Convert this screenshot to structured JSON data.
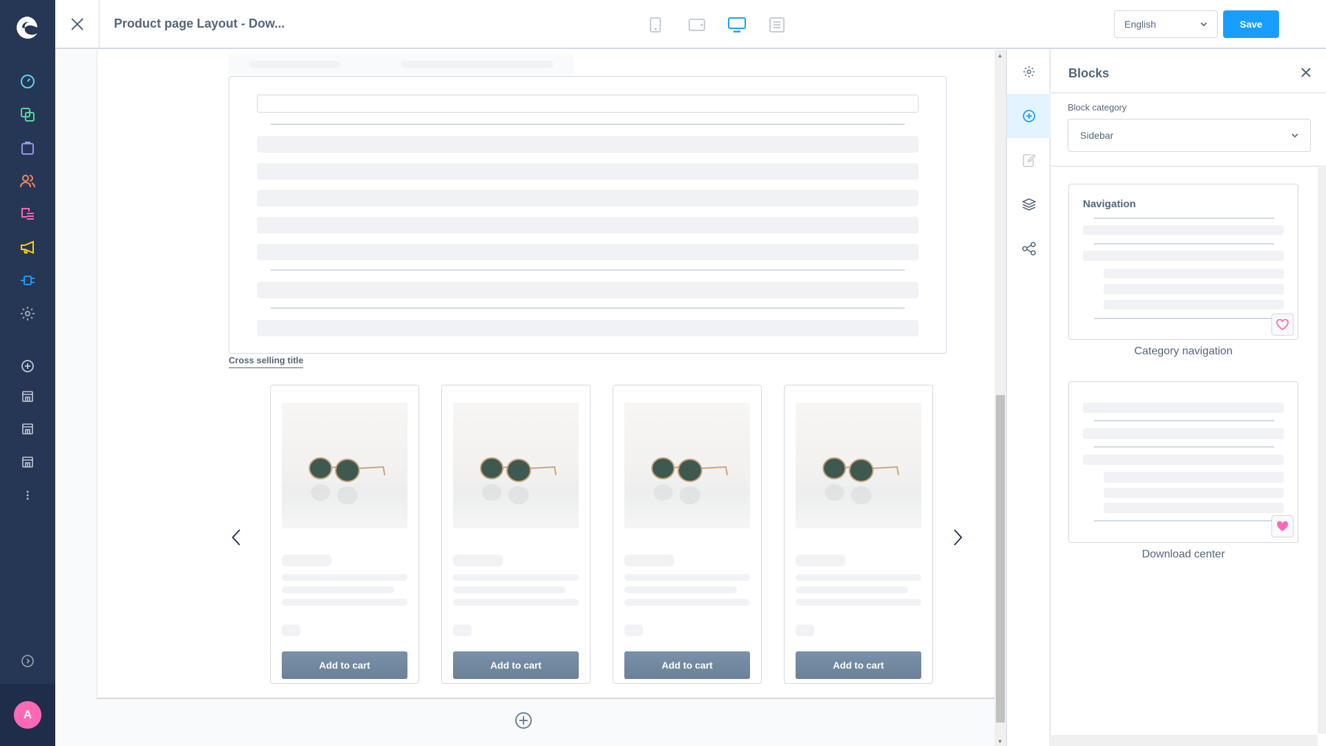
{
  "header": {
    "title": "Product page Layout - Dow...",
    "devices": [
      {
        "name": "mobile",
        "active": false
      },
      {
        "name": "tablet",
        "active": false
      },
      {
        "name": "desktop",
        "active": true
      },
      {
        "name": "form",
        "active": false
      }
    ],
    "language": "English",
    "save_label": "Save"
  },
  "leftnav": {
    "items": [
      {
        "name": "dashboard",
        "color": "#57d9f3"
      },
      {
        "name": "catalogues",
        "color": "#57d9a3"
      },
      {
        "name": "orders",
        "color": "#a092f0"
      },
      {
        "name": "customers",
        "color": "#f88962"
      },
      {
        "name": "content",
        "color": "#ff68b4"
      },
      {
        "name": "marketing",
        "color": "#ffd700"
      },
      {
        "name": "extensions",
        "color": "#189eff"
      },
      {
        "name": "settings",
        "color": "#9aa8b5"
      }
    ],
    "sales_channels": [
      "storefront-1",
      "storefront-2",
      "storefront-3"
    ],
    "avatar_initial": "A"
  },
  "canvas": {
    "cross_selling_title": "Cross selling title",
    "products": [
      {
        "button": "Add to cart"
      },
      {
        "button": "Add to cart"
      },
      {
        "button": "Add to cart"
      },
      {
        "button": "Add to cart"
      }
    ]
  },
  "rail": {
    "items": [
      "settings",
      "add-blocks",
      "edit",
      "layers",
      "share"
    ],
    "active": "add-blocks"
  },
  "panel": {
    "title": "Blocks",
    "category_label": "Block category",
    "category_value": "Sidebar",
    "blocks": [
      {
        "preview_title": "Navigation",
        "label": "Category navigation",
        "favorite": false
      },
      {
        "preview_title": "",
        "label": "Download center",
        "favorite": true
      }
    ]
  },
  "colors": {
    "accent": "#189eff",
    "nav_bg": "#263755",
    "favorite": "#ff68b4"
  }
}
